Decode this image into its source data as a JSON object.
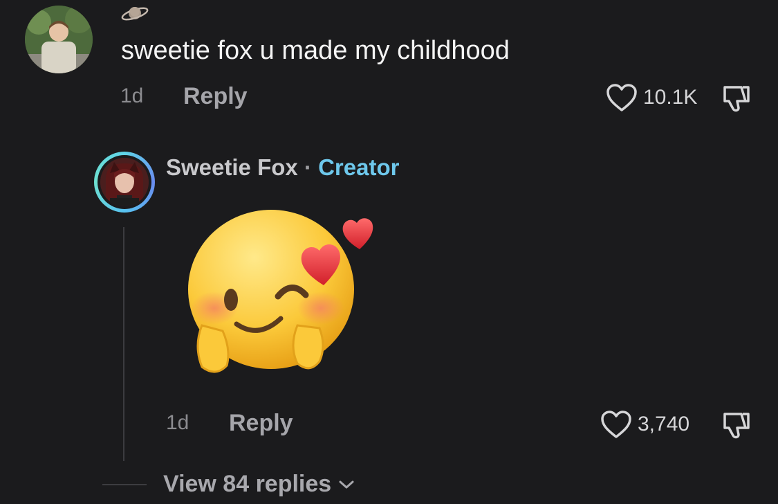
{
  "comment": {
    "badge_icon": "planet-icon",
    "text": "sweetie fox u made my childhood",
    "time": "1d",
    "reply_label": "Reply",
    "likes": "10.1K"
  },
  "reply": {
    "author": "Sweetie Fox",
    "separator": "·",
    "badge": "Creator",
    "content_icon": "smiling-face-with-hearts-emoji",
    "time": "1d",
    "reply_label": "Reply",
    "likes": "3,740"
  },
  "thread": {
    "view_replies_label": "View 84 replies"
  },
  "colors": {
    "background": "#1b1b1d",
    "creator_accent": "#6ec8ec",
    "muted_text": "#a5a5aa"
  }
}
